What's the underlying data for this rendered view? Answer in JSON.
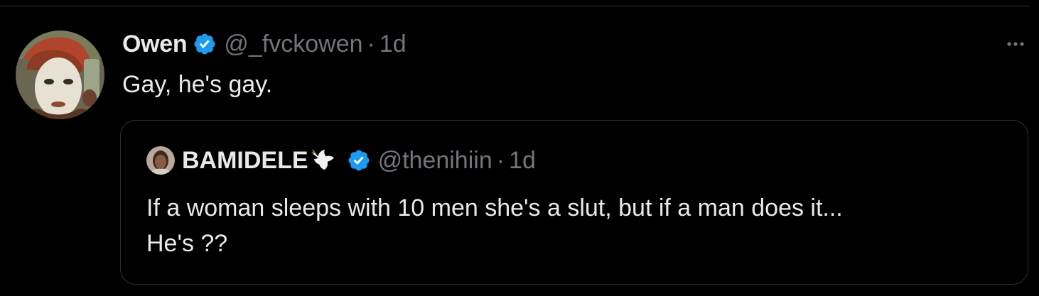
{
  "tweet": {
    "author": {
      "display_name": "Owen",
      "handle": "@_fvckowen",
      "verified": true,
      "avatar_icon": "avatar-photo"
    },
    "separator": "·",
    "time": "1d",
    "text": "Gay, he's gay.",
    "more_icon": "ellipsis-icon"
  },
  "quote": {
    "author": {
      "display_name": "BAMIDELE",
      "name_emoji": "dove-icon",
      "handle": "@thenihiin",
      "verified": true
    },
    "separator": "·",
    "time": "1d",
    "text_lines": [
      "If a woman sleeps with 10 men she's a slut, but if a man does it...",
      "He's ??"
    ]
  },
  "colors": {
    "background": "#000000",
    "text": "#e7e9ea",
    "secondary_text": "#71767b",
    "verified_blue": "#1d9bf0",
    "border": "#2f3336"
  }
}
